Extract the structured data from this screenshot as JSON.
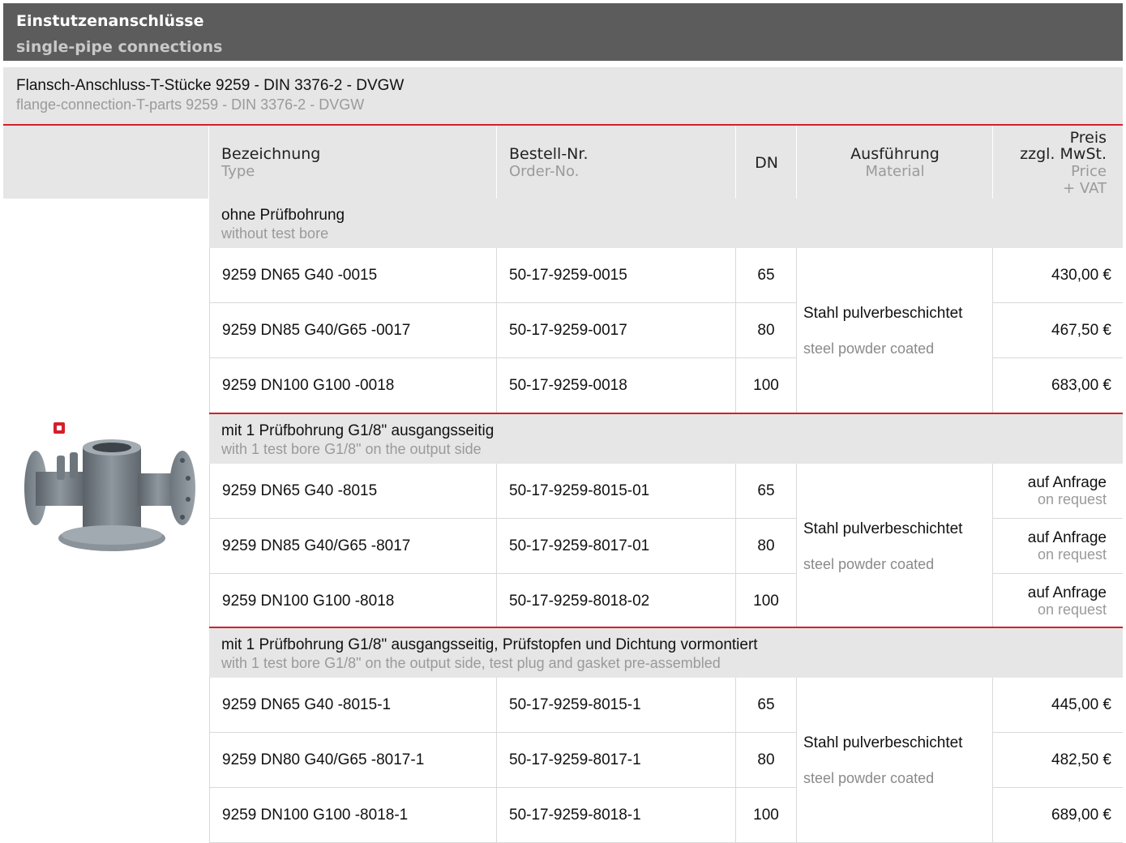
{
  "header": {
    "title": "Einstutzenanschlüsse",
    "subtitle": "single-pipe connections"
  },
  "product": {
    "title_de": "Flansch-Anschluss-T-Stücke 9259 - DIN 3376-2 - DVGW",
    "title_en": "flange-connection-T-parts 9259 - DIN 3376-2 - DVGW"
  },
  "columns": {
    "type_de": "Bezeichnung",
    "type_en": "Type",
    "order_de": "Bestell-Nr.",
    "order_en": "Order-No.",
    "dn": "DN",
    "material_de": "Ausführung",
    "material_en": "Material",
    "price_de_1": "Preis",
    "price_de_2": "zzgl. MwSt.",
    "price_en_1": "Price",
    "price_en_2": "+ VAT"
  },
  "colors": {
    "accent": "#d3202b",
    "header_bg": "#5c5c5c",
    "section_bg": "#e6e6e6"
  },
  "sections": [
    {
      "title_de": "ohne Prüfbohrung",
      "title_en": "without test bore",
      "material_de": "Stahl pulverbeschichtet",
      "material_en": "steel powder coated",
      "rows": [
        {
          "type": "9259 DN65 G40 -0015",
          "order": "50-17-9259-0015",
          "dn": "65",
          "price": "430,00 €"
        },
        {
          "type": "9259 DN85 G40/G65 -0017",
          "order": "50-17-9259-0017",
          "dn": "80",
          "price": "467,50 €"
        },
        {
          "type": "9259 DN100 G100 -0018",
          "order": "50-17-9259-0018",
          "dn": "100",
          "price": "683,00 €"
        }
      ]
    },
    {
      "title_de": "mit 1 Prüfbohrung G1/8\" ausgangsseitig",
      "title_en": "with 1 test bore G1/8\" on the output side",
      "material_de": "Stahl pulverbeschichtet",
      "material_en": "steel powder coated",
      "rows": [
        {
          "type": "9259 DN65 G40 -8015",
          "order": "50-17-9259-8015-01",
          "dn": "65",
          "price_de": "auf Anfrage",
          "price_en": "on request"
        },
        {
          "type": "9259 DN85 G40/G65 -8017",
          "order": "50-17-9259-8017-01",
          "dn": "80",
          "price_de": "auf Anfrage",
          "price_en": "on request"
        },
        {
          "type": "9259 DN100 G100 -8018",
          "order": "50-17-9259-8018-02",
          "dn": "100",
          "price_de": "auf Anfrage",
          "price_en": "on request"
        }
      ]
    },
    {
      "title_de": "mit 1 Prüfbohrung G1/8\" ausgangsseitig, Prüfstopfen und Dichtung vormontiert",
      "title_en": "with 1 test bore G1/8\" on the output side, test plug and gasket pre-assembled",
      "material_de": "Stahl pulverbeschichtet",
      "material_en": "steel powder coated",
      "rows": [
        {
          "type": "9259 DN65 G40 -8015-1",
          "order": "50-17-9259-8015-1",
          "dn": "65",
          "price": "445,00 €"
        },
        {
          "type": "9259 DN80 G40/G65 -8017-1",
          "order": "50-17-9259-8017-1",
          "dn": "80",
          "price": "482,50 €"
        },
        {
          "type": "9259 DN100 G100 -8018-1",
          "order": "50-17-9259-8018-1",
          "dn": "100",
          "price": "689,00 €"
        }
      ]
    }
  ]
}
